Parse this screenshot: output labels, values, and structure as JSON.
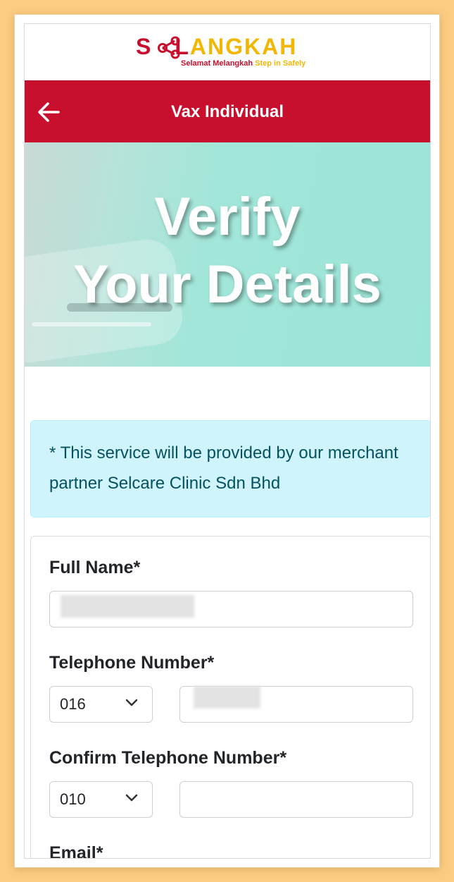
{
  "logo": {
    "wordmark_start": "S",
    "wordmark_l": "L",
    "wordmark_rest": "ANGKAH",
    "tagline_red": "Selamat Melangkah",
    "tagline_yellow": "Step in Safely"
  },
  "header": {
    "title": "Vax Individual",
    "back_icon": "arrow-left-icon",
    "color": "#c8102e"
  },
  "hero": {
    "title_line1": "Verify",
    "title_line2": "Your Details"
  },
  "alert": {
    "text": "* This service will be provided by our merchant partner Selcare Clinic Sdn Bhd"
  },
  "form": {
    "full_name": {
      "label": "Full Name*",
      "value": ""
    },
    "telephone": {
      "label": "Telephone Number*",
      "prefix": "016",
      "value": ""
    },
    "confirm_telephone": {
      "label": "Confirm Telephone Number*",
      "prefix": "010",
      "value": ""
    },
    "email": {
      "label": "Email*"
    }
  },
  "colors": {
    "brand_red": "#c8102e",
    "brand_yellow": "#f2b705",
    "hero_teal": "#9be5d8",
    "alert_bg": "#cff4fc",
    "alert_text": "#055160",
    "page_bg": "#fbcc82"
  }
}
